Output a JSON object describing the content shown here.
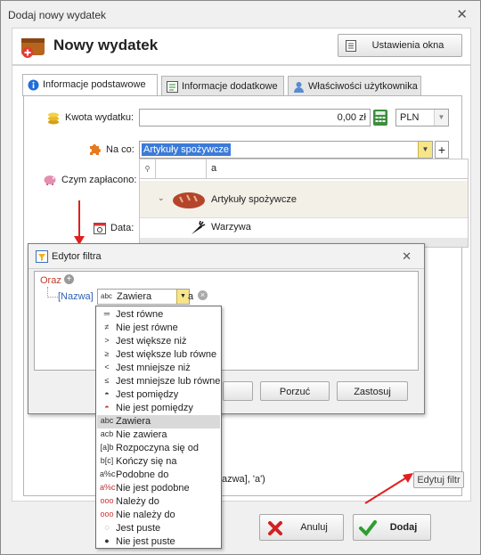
{
  "window": {
    "title": "Dodaj nowy wydatek",
    "close": "✕"
  },
  "header": {
    "title": "Nowy wydatek",
    "settings_button": "Ustawienia okna"
  },
  "tabs": [
    {
      "label": "Informacje podstawowe"
    },
    {
      "label": "Informacje dodatkowe"
    },
    {
      "label": "Właściwości użytkownika"
    }
  ],
  "form": {
    "amount_label": "Kwota wydatku:",
    "amount_value": "0,00 zł",
    "currency": "PLN",
    "category_label": "Na co:",
    "category_value": "Artykuły spożywcze",
    "add": "+",
    "payment_label": "Czym zapłacono:",
    "date_label": "Data:"
  },
  "grid": {
    "filter_text": "a",
    "rows": [
      {
        "label": "Artykuły spożywcze"
      },
      {
        "label": "Warzywa"
      }
    ]
  },
  "filter_dialog": {
    "title": "Edytor filtra",
    "group": "Oraz",
    "field": "[Nazwa]",
    "operator": "Zawiera",
    "value": "a",
    "buttons": [
      "Porzuć",
      "Zastosuj"
    ],
    "operator_options": [
      {
        "glyph": "═",
        "label": "Jest równe"
      },
      {
        "glyph": "≠",
        "label": "Nie jest równe"
      },
      {
        "glyph": ">",
        "label": "Jest większe niż"
      },
      {
        "glyph": "≥",
        "label": "Jest większe lub równe"
      },
      {
        "glyph": "<",
        "label": "Jest mniejsze niż"
      },
      {
        "glyph": "≤",
        "label": "Jest mniejsze lub równe"
      },
      {
        "glyph": "◓",
        "label": "Jest pomiędzy"
      },
      {
        "glyph": "◓",
        "label": "Nie jest pomiędzy"
      },
      {
        "glyph": "abc",
        "label": "Zawiera"
      },
      {
        "glyph": "acb",
        "label": "Nie zawiera"
      },
      {
        "glyph": "[a]b",
        "label": "Rozpoczyna się od"
      },
      {
        "glyph": "b[c]",
        "label": "Kończy się na"
      },
      {
        "glyph": "a%c",
        "label": "Podobne do"
      },
      {
        "glyph": "a%c",
        "label": "Nie jest podobne"
      },
      {
        "glyph": "ooo",
        "label": "Należy do"
      },
      {
        "glyph": "ooo",
        "label": "Nie należy do"
      },
      {
        "glyph": "◌",
        "label": "Jest puste"
      },
      {
        "glyph": "●",
        "label": "Nie jest puste"
      }
    ],
    "selected_index": 8
  },
  "filter_bar": {
    "expression_tail": "azwa], 'a')",
    "edit_button": "Edytuj filtr"
  },
  "footer": {
    "cancel": "Anuluj",
    "add": "Dodaj"
  }
}
